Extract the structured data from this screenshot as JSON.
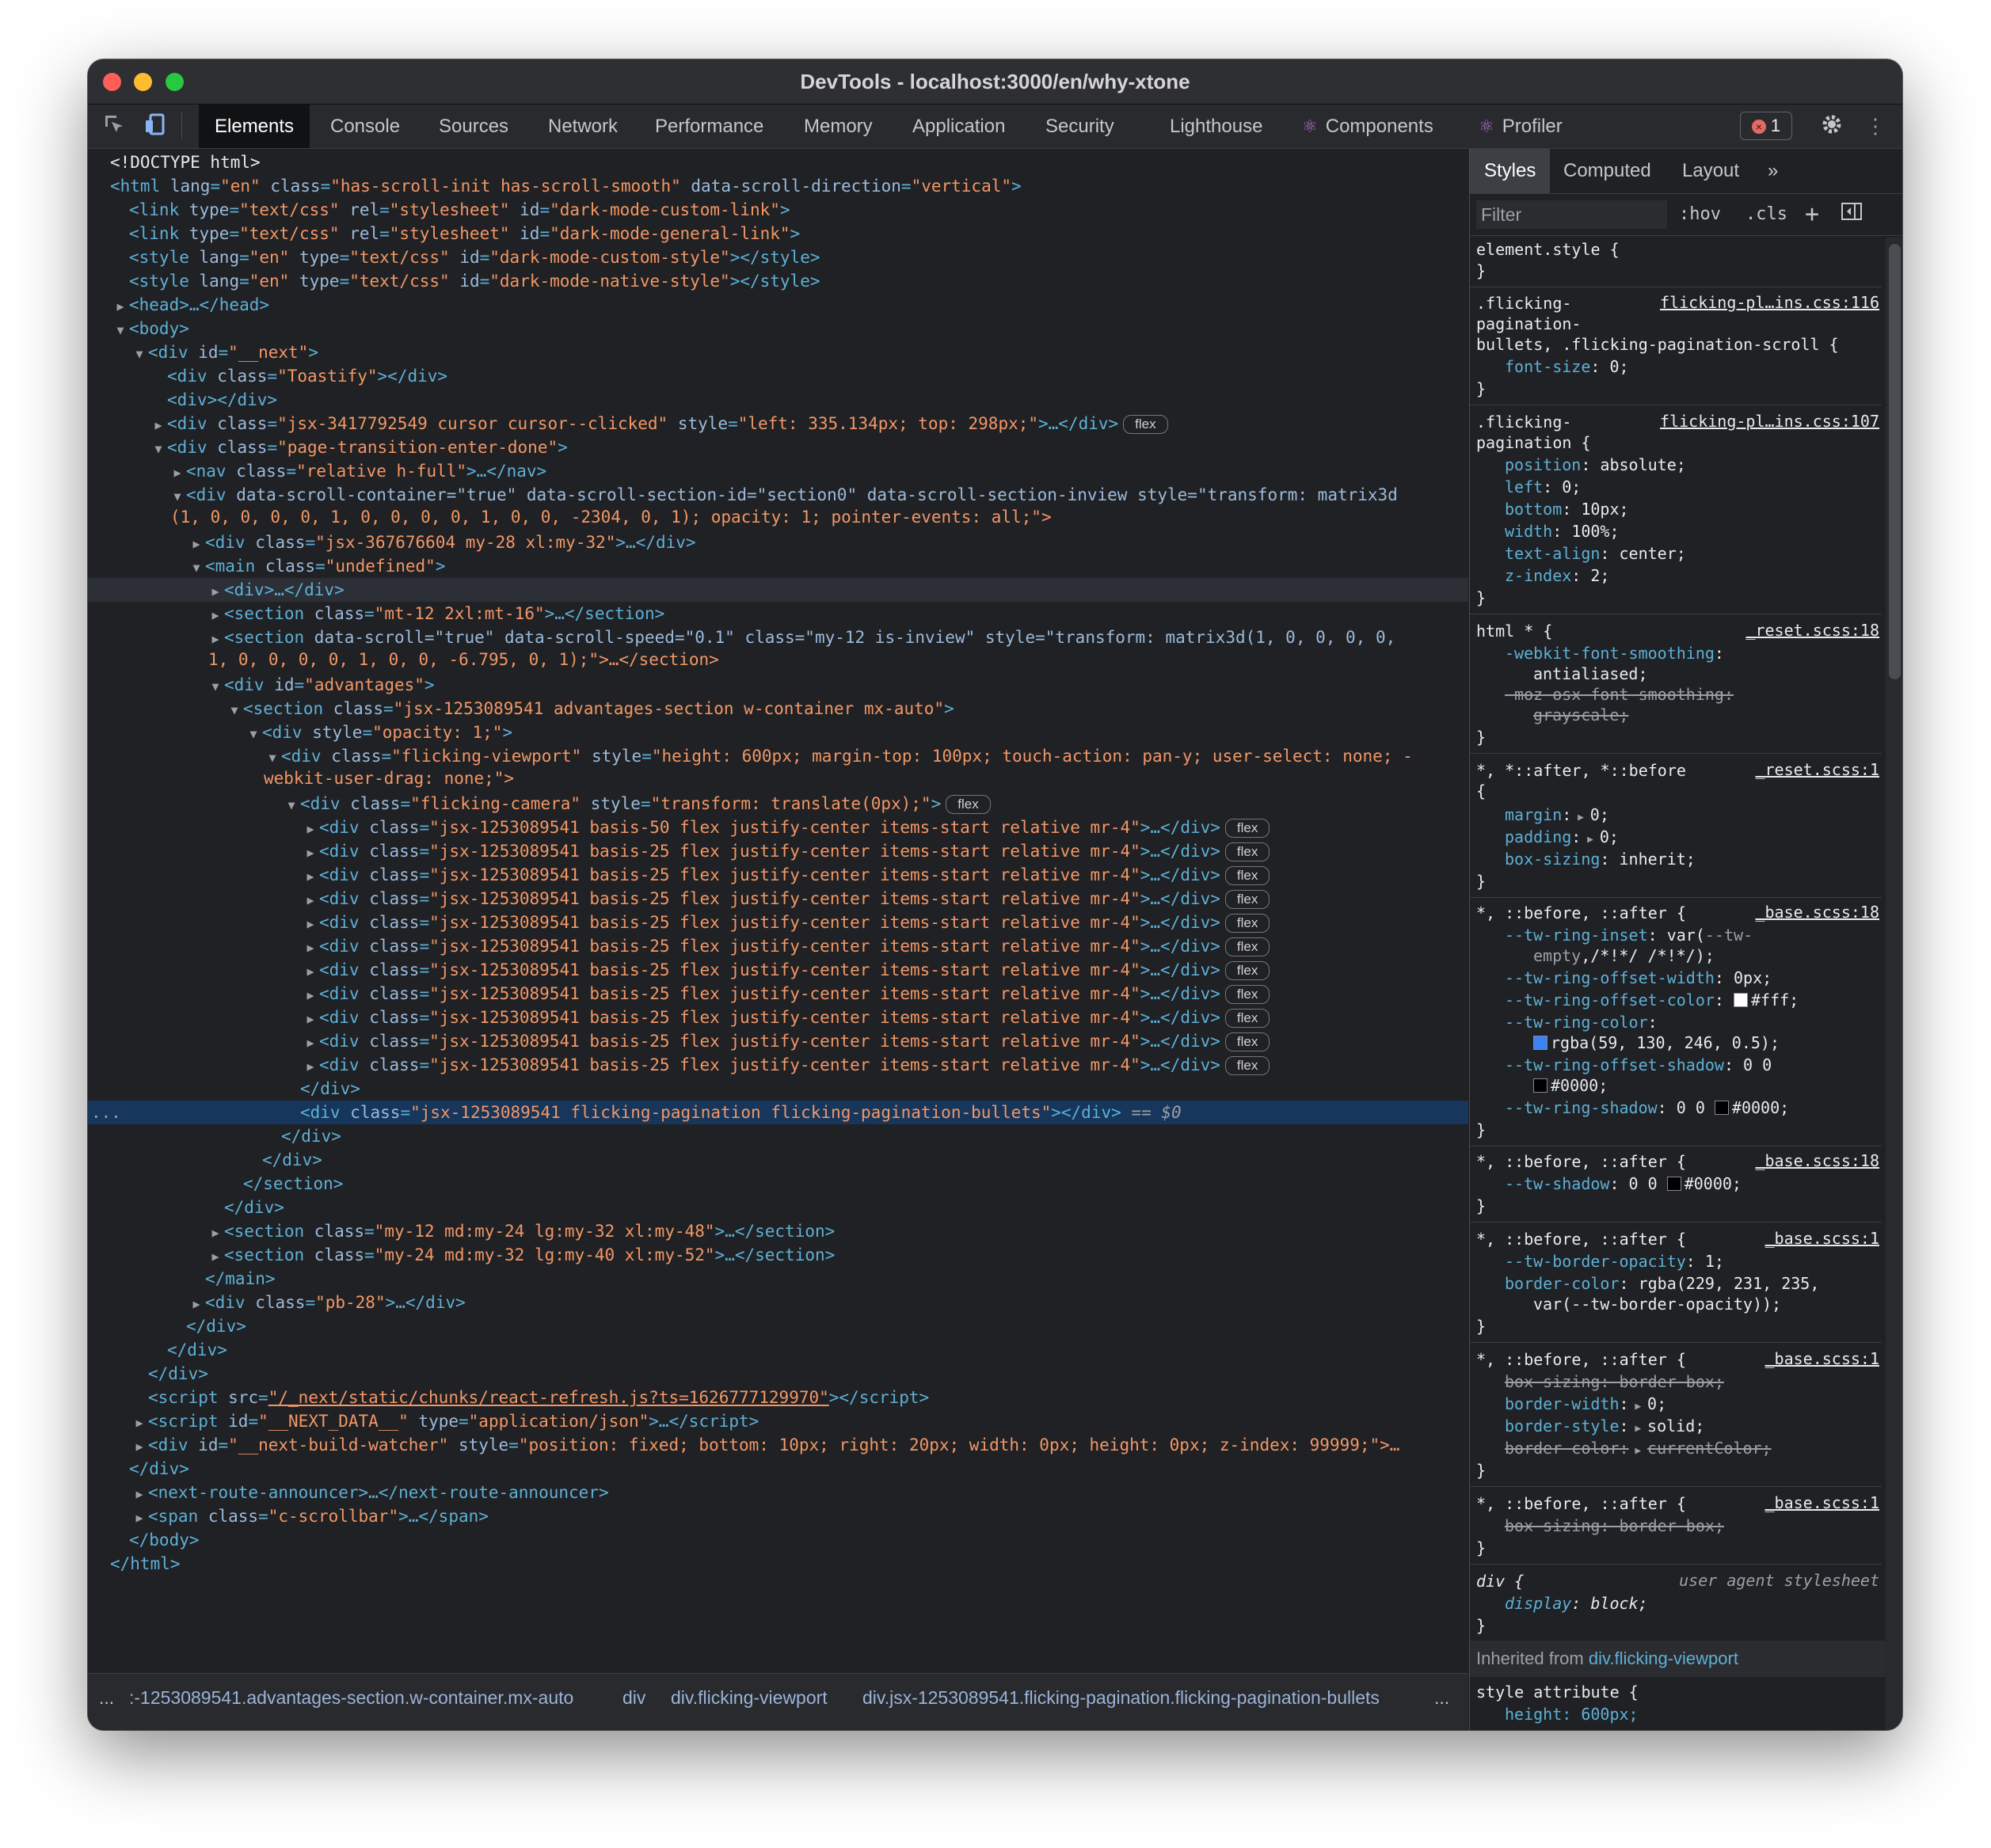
{
  "window": {
    "title": "DevTools - localhost:3000/en/why-xtone"
  },
  "toolbar": {
    "tabs": [
      "Elements",
      "Console",
      "Sources",
      "Network",
      "Performance",
      "Memory",
      "Application",
      "Security",
      "Lighthouse",
      "Components",
      "Profiler"
    ],
    "error_count": "1",
    "icons": [
      "inspect-icon",
      "device-toolbar-icon",
      "gear-icon",
      "kebab-menu-icon"
    ]
  },
  "dom": {
    "l0": "<!DOCTYPE html>",
    "l1_tag": "<html",
    "l1_a": "lang",
    "l1_v": "\"en\"",
    "l1_a2": "class",
    "l1_v2": "\"has-scroll-init has-scroll-smooth\"",
    "l1_a3": "data-scroll-direction",
    "l1_v3": "\"vertical\"",
    "link1": "\"dark-mode-custom-link\"",
    "link2": "\"dark-mode-general-link\"",
    "style1": "\"dark-mode-custom-style\"",
    "style2": "\"dark-mode-native-style\"",
    "head": "<head>…</head>",
    "body": "<body>",
    "next_id": "\"__next\"",
    "toastify": "\"Toastify\"",
    "empty_div": "<div></div>",
    "cursor_class": "\"jsx-3417792549 cursor cursor--clicked\"",
    "cursor_style": "\"left: 335.134px; top: 298px;\"",
    "pt_class": "\"page-transition-enter-done\"",
    "nav_class": "\"relative h-full\"",
    "dsc_line1": "data-scroll-container=\"true\" data-scroll-section-id=\"section0\" data-scroll-section-inview style=\"transform: matrix3d",
    "dsc_line2": "(1, 0, 0, 0, 0, 1, 0, 0, 0, 0, 1, 0, 0, -2304, 0, 1); opacity: 1; pointer-events: all;\">",
    "jsx367_class": "\"jsx-367676604 my-28 xl:my-32\"",
    "main_class": "\"undefined\"",
    "div_collapsed": "<div>…</div>",
    "sec1_class": "\"mt-12 2xl:mt-16\"",
    "sec2_line1": "data-scroll=\"true\" data-scroll-speed=\"0.1\" class=\"my-12 is-inview\" style=\"transform: matrix3d(1, 0, 0, 0, 0,",
    "sec2_line2": "1, 0, 0, 0, 0, 1, 0, 0, -6.795, 0, 1);\">…</section>",
    "adv_id": "\"advantages\"",
    "advsec_class": "\"jsx-1253089541 advantages-section w-container mx-auto\"",
    "opacity_style": "\"opacity: 1;\"",
    "vp_line1_class": "\"flicking-viewport\"",
    "vp_line1_style": "\"height: 600px; margin-top: 100px; touch-action: pan-y; user-select: none; -",
    "vp_line2": "webkit-user-drag: none;\">",
    "camera_class": "\"flicking-camera\"",
    "camera_style": "\"transform: translate(0px);\"",
    "panel_first": "\"jsx-1253089541 basis-50 flex justify-center items-start relative mr-4\"",
    "panel": "\"jsx-1253089541 basis-25 flex justify-center items-start relative mr-4\"",
    "close_div": "</div>",
    "sel_class": "\"jsx-1253089541 flicking-pagination flicking-pagination-bullets\"",
    "sel_eq": "== $0",
    "close_section": "</section>",
    "close_main": "</main>",
    "secA_class": "\"my-12 md:my-24 lg:my-32 xl:my-48\"",
    "secB_class": "\"my-24 md:my-32 lg:my-40 xl:my-52\"",
    "pb_class": "\"pb-28\"",
    "script_src": "\"/_next/static/chunks/react-refresh.js?ts=1626777129970\"",
    "script_id": "\"__NEXT_DATA__\"",
    "script_type": "\"application/json\"",
    "bw_id": "\"__next-build-watcher\"",
    "bw_style": "\"position: fixed; bottom: 10px; right: 20px; width: 0px; height: 0px; z-index: 99999;\">…",
    "nra": "<next-route-announcer>…</next-route-announcer>",
    "scrollbar_class": "\"c-scrollbar\"",
    "close_body": "</body>",
    "close_html": "</html>",
    "flex_badge": "flex",
    "row_dots": "..."
  },
  "breadcrumb": {
    "dots": "...",
    "c1": ":-1253089541.advantages-section.w-container.mx-auto",
    "c2": "div",
    "c3": "div.flicking-viewport",
    "c4": "div.jsx-1253089541.flicking-pagination.flicking-pagination-bullets",
    "more": "..."
  },
  "sidebar": {
    "tabs": [
      "Styles",
      "Computed",
      "Layout"
    ],
    "more_tabs": "»",
    "filter_placeholder": "Filter",
    "hov": ":hov",
    "cls": ".cls",
    "plus": "+",
    "element_style": "element.style {",
    "close": "}",
    "r1_sel_a": ".flicking-",
    "r1_sel_b": "pagination-",
    "r1_sel_c": "bullets, .flicking-pagination-scroll {",
    "r1_src": "flicking-pl…ins.css:116",
    "r1_p1": "font-size",
    "r1_v1": "0;",
    "r2_sel_a": ".flicking-",
    "r2_sel_b": "pagination {",
    "r2_src": "flicking-pl…ins.css:107",
    "r2_props": [
      {
        "p": "position",
        "v": "absolute;"
      },
      {
        "p": "left",
        "v": "0;"
      },
      {
        "p": "bottom",
        "v": "10px;"
      },
      {
        "p": "width",
        "v": "100%;"
      },
      {
        "p": "text-align",
        "v": "center;"
      },
      {
        "p": "z-index",
        "v": "2;"
      }
    ],
    "r3_sel": "html * {",
    "r3_src": "_reset.scss:18",
    "r3_p1": "-webkit-font-smoothing",
    "r3_v1": "antialiased;",
    "r3_p2": "-moz-osx-font-smoothing:",
    "r3_v2": "grayscale;",
    "r4_sel_a": "*, *::after, *::before",
    "r4_sel_b": "{",
    "r4_src": "_reset.scss:1",
    "r4_p1": "margin",
    "r4_v1": "0;",
    "r4_p2": "padding",
    "r4_v2": "0;",
    "r4_p3": "box-sizing",
    "r4_v3": "inherit;",
    "r5_sel": "*, ::before, ::after {",
    "r5_src": "_base.scss:18",
    "r5_p1": "--tw-ring-inset",
    "r5_v1a": "var(",
    "r5_v1b": "--tw-",
    "r5_v1c": "empty",
    "r5_v1d": ",/*!*/ /*!*/);",
    "r5_p2": "--tw-ring-offset-width",
    "r5_v2": "0px;",
    "r5_p3": "--tw-ring-offset-color",
    "r5_v3": "#fff;",
    "r5_p4": "--tw-ring-color",
    "r5_v4": "rgba(59, 130, 246, 0.5);",
    "r5_p5": "--tw-ring-offset-shadow",
    "r5_v5a": "0 0",
    "r5_v5b": "#0000;",
    "r5_p6": "--tw-ring-shadow",
    "r5_v6a": "0 0",
    "r5_v6b": "#0000;",
    "r6_sel": "*, ::before, ::after {",
    "r6_src": "_base.scss:18",
    "r6_p1": "--tw-shadow",
    "r6_v1a": "0 0",
    "r6_v1b": "#0000;",
    "r7_sel": "*, ::before, ::after {",
    "r7_src": "_base.scss:1",
    "r7_p1": "--tw-border-opacity",
    "r7_v1": "1;",
    "r7_p2": "border-color",
    "r7_v2a": "rgba(229, 231, 235,",
    "r7_v2b": "var(--tw-border-opacity));",
    "r8_sel": "*, ::before, ::after {",
    "r8_src": "_base.scss:1",
    "r8_p1": "box-sizing: border-box;",
    "r8_p2": "border-width",
    "r8_v2": "0;",
    "r8_p3": "border-style",
    "r8_v3": "solid;",
    "r8_p4": "border-color:",
    "r8_v4": "currentColor;",
    "r9_sel": "*, ::before, ::after {",
    "r9_src": "_base.scss:1",
    "r9_p1": "box-sizing: border-box;",
    "r10_sel": "div {",
    "r10_src": "user agent stylesheet",
    "r10_p1": "display",
    "r10_v1": "block;",
    "inherited_label": "Inherited from",
    "inherited_from": "div.flicking-viewport",
    "r11_sel": "style attribute {",
    "r11_p1": "height: 600px;"
  },
  "colors": {
    "swatch_white": "#ffffff",
    "swatch_blue": "#3b82f6",
    "swatch_black": "#000000",
    "traffic_red": "#ff5f57",
    "traffic_yellow": "#febc2e",
    "traffic_green": "#28c840"
  }
}
